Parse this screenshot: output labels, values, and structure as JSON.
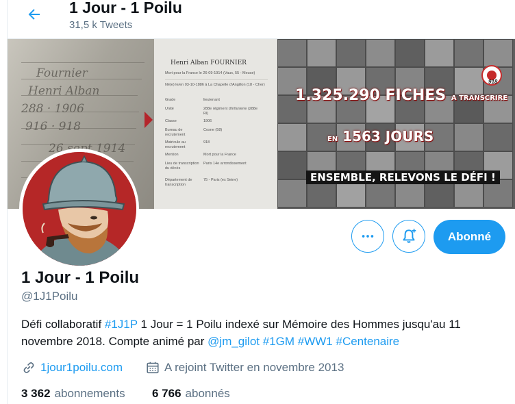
{
  "header": {
    "title": "1 Jour - 1 Poilu",
    "tweet_count": "31,5 k Tweets"
  },
  "banner": {
    "record_name": "Henri Alban FOURNIER",
    "record_death": "Mort pour la France le 26-09-1914 (Vaux, 55 - Meuse)",
    "record_birth": "Né(e) le/en 03-10-1886 à La Chapelle d'Angillon (18 - Cher)",
    "record_fields": [
      {
        "label": "Grade",
        "value": "lieutenant"
      },
      {
        "label": "Unité",
        "value": "288e régiment d'infanterie (288e RI)"
      },
      {
        "label": "Classe",
        "value": "1906"
      },
      {
        "label": "Bureau de recrutement",
        "value": "Cosne (58)"
      },
      {
        "label": "Matricule au recrutement",
        "value": "918"
      },
      {
        "label": "Mention",
        "value": "Mort pour la France"
      },
      {
        "label": "Lieu de transcription du décès",
        "value": "Paris 14e arrondissement"
      },
      {
        "label": "Département de transcription",
        "value": "75 - Paris (ex Seine)"
      }
    ],
    "line1_number": "1.325.290 FICHES",
    "line1_small": "A TRANSCRIRE",
    "line2_small": "EN",
    "line2_number": "1563 JOURS",
    "line3": "ENSEMBLE, RELEVONS LE DÉFI !",
    "logo_year": "918"
  },
  "actions": {
    "more_icon": "more-horizontal-icon",
    "notif_icon": "bell-plus-icon",
    "follow_label": "Abonné"
  },
  "profile": {
    "name": "1 Jour - 1 Poilu",
    "handle": "@1J1Poilu",
    "bio_1": "Défi collaboratif ",
    "bio_tag1": "#1J1P",
    "bio_2": " 1 Jour = 1 Poilu indexé sur Mémoire des Hommes jusqu'au 11 novembre 2018. Compte animé par ",
    "bio_mention": "@jm_gilot",
    "bio_tag2": "#1GM",
    "bio_tag3": "#WW1",
    "bio_tag4": "#Centenaire",
    "website": "1jour1poilu.com",
    "joined": "A rejoint Twitter en novembre 2013"
  },
  "stats": {
    "following_count": "3 362",
    "following_label": "abonnements",
    "followers_count": "6 766",
    "followers_label": "abonnés"
  },
  "colors": {
    "accent": "#1d9bf0",
    "text": "#0f1419",
    "muted": "#5b7083",
    "banner_red": "#b4252b"
  }
}
